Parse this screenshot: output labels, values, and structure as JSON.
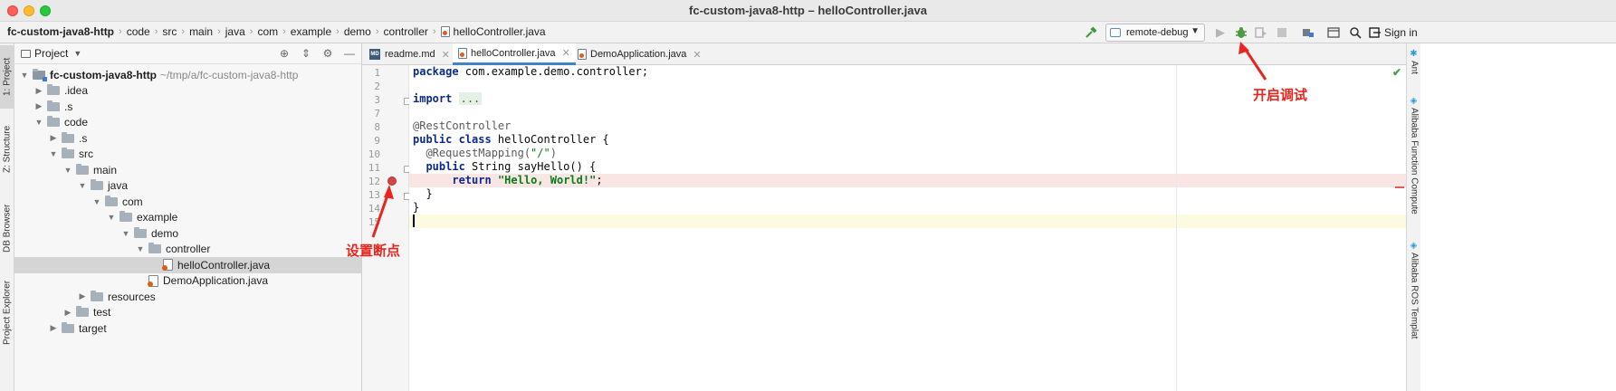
{
  "window": {
    "title": "fc-custom-java8-http – helloController.java"
  },
  "breadcrumbs": [
    "fc-custom-java8-http",
    "code",
    "src",
    "main",
    "java",
    "com",
    "example",
    "demo",
    "controller",
    "helloController.java"
  ],
  "toolbar": {
    "run_config": "remote-debug",
    "sign_in": "Sign in"
  },
  "left_stripe": {
    "tabs": [
      "1: Project",
      "Z: Structure",
      "DB Browser",
      "Project Explorer"
    ]
  },
  "project_panel": {
    "title": "Project",
    "tree": [
      {
        "label": "fc-custom-java8-http",
        "hint": "~/tmp/a/fc-custom-java8-http",
        "depth": 0,
        "expanded": true,
        "type": "module"
      },
      {
        "label": ".idea",
        "depth": 1,
        "expanded": false,
        "type": "folder"
      },
      {
        "label": ".s",
        "depth": 1,
        "expanded": false,
        "type": "folder"
      },
      {
        "label": "code",
        "depth": 1,
        "expanded": true,
        "type": "folder"
      },
      {
        "label": ".s",
        "depth": 2,
        "expanded": false,
        "type": "folder"
      },
      {
        "label": "src",
        "depth": 2,
        "expanded": true,
        "type": "folder"
      },
      {
        "label": "main",
        "depth": 3,
        "expanded": true,
        "type": "folder"
      },
      {
        "label": "java",
        "depth": 4,
        "expanded": true,
        "type": "folder"
      },
      {
        "label": "com",
        "depth": 5,
        "expanded": true,
        "type": "folder"
      },
      {
        "label": "example",
        "depth": 6,
        "expanded": true,
        "type": "folder"
      },
      {
        "label": "demo",
        "depth": 7,
        "expanded": true,
        "type": "folder"
      },
      {
        "label": "controller",
        "depth": 8,
        "expanded": true,
        "type": "folder"
      },
      {
        "label": "helloController.java",
        "depth": 9,
        "type": "java",
        "selected": true
      },
      {
        "label": "DemoApplication.java",
        "depth": 8,
        "type": "java"
      },
      {
        "label": "resources",
        "depth": 4,
        "expanded": false,
        "type": "folder"
      },
      {
        "label": "test",
        "depth": 3,
        "expanded": false,
        "type": "folder"
      },
      {
        "label": "target",
        "depth": 2,
        "expanded": false,
        "type": "folder"
      }
    ]
  },
  "editor": {
    "tabs": [
      {
        "label": "readme.md",
        "icon": "md"
      },
      {
        "label": "helloController.java",
        "icon": "java",
        "active": true
      },
      {
        "label": "DemoApplication.java",
        "icon": "java"
      }
    ],
    "line_numbers": [
      "1",
      "2",
      "3",
      "7",
      "8",
      "9",
      "10",
      "11",
      "12",
      "13",
      "14",
      "15"
    ],
    "breakpoint_line": "12",
    "current_line": "15"
  },
  "right_stripe": {
    "tabs": [
      "Ant",
      "Alibaba Function Compute",
      "Alibaba ROS Templat"
    ]
  },
  "annotations": {
    "breakpoint": "设置断点",
    "debug": "开启调试"
  },
  "colors": {
    "annotation": "#e8261f",
    "breakpoint": "#d64545",
    "keyword": "#0c2a8a",
    "string": "#067d17",
    "active_tab_underline": "#4083c9"
  }
}
